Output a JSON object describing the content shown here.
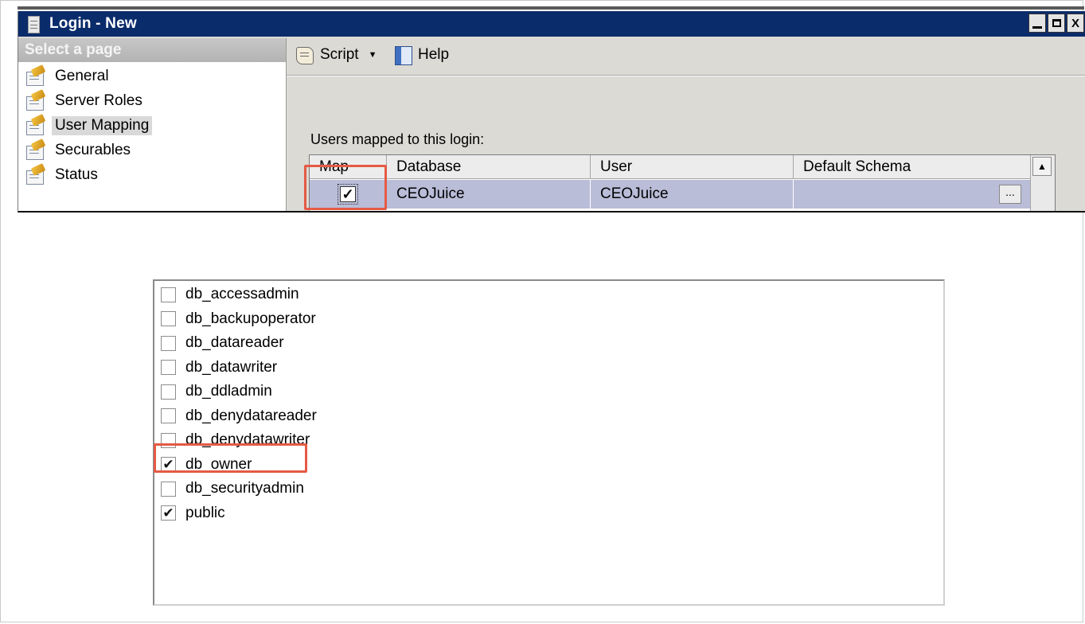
{
  "window": {
    "title": "Login - New",
    "controls": [
      "minimize-icon",
      "maximize-icon",
      "close-icon"
    ],
    "close_glyph": "X"
  },
  "sidebar": {
    "header": "Select a page",
    "items": [
      {
        "label": "General",
        "active": false
      },
      {
        "label": "Server Roles",
        "active": false
      },
      {
        "label": "User Mapping",
        "active": true
      },
      {
        "label": "Securables",
        "active": false
      },
      {
        "label": "Status",
        "active": false
      }
    ]
  },
  "toolbar": {
    "script_label": "Script",
    "help_label": "Help"
  },
  "mapping": {
    "label": "Users mapped to this login:",
    "columns": [
      "Map",
      "Database",
      "User",
      "Default Schema"
    ],
    "rows": [
      {
        "map": true,
        "database": "CEOJuice",
        "user": "CEOJuice",
        "default_schema": ""
      }
    ],
    "ellipsis": "..."
  },
  "roles": {
    "items": [
      {
        "label": "db_accessadmin",
        "checked": false
      },
      {
        "label": "db_backupoperator",
        "checked": false
      },
      {
        "label": "db_datareader",
        "checked": false
      },
      {
        "label": "db_datawriter",
        "checked": false
      },
      {
        "label": "db_ddladmin",
        "checked": false
      },
      {
        "label": "db_denydatareader",
        "checked": false
      },
      {
        "label": "db_denydatawriter",
        "checked": false
      },
      {
        "label": "db_owner",
        "checked": true
      },
      {
        "label": "db_securityadmin",
        "checked": false
      },
      {
        "label": "public",
        "checked": true
      }
    ]
  },
  "colors": {
    "titlebar": "#0b2c6b",
    "highlight_box": "#e55a45",
    "selected_row": "#b9bdd8",
    "dialog_bg": "#dcdad5"
  }
}
